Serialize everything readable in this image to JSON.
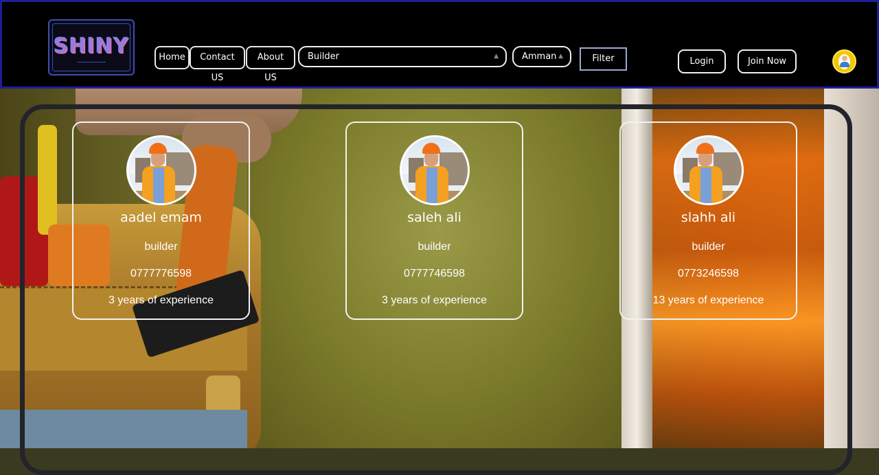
{
  "header": {
    "logo_text": "SHINY",
    "nav": [
      "Home",
      "Contact US",
      "About US"
    ],
    "category_select": {
      "value": "Builder"
    },
    "city_select": {
      "value": "Amman"
    },
    "filter_label": "Filter",
    "login_label": "Login",
    "join_label": "Join Now"
  },
  "workers": [
    {
      "name": "aadel emam",
      "trade": "builder",
      "phone": "0777776598",
      "experience": "3 years of experience"
    },
    {
      "name": "saleh ali",
      "trade": "builder",
      "phone": "0777746598",
      "experience": "3 years of experience"
    },
    {
      "name": "slahh ali",
      "trade": "builder",
      "phone": "0773246598",
      "experience": "13 years of experience"
    }
  ],
  "colors": {
    "header_bg": "#000000",
    "header_border": "#1e1e9a",
    "panel_border": "#22242a",
    "avatar_accent": "#f2c800"
  }
}
